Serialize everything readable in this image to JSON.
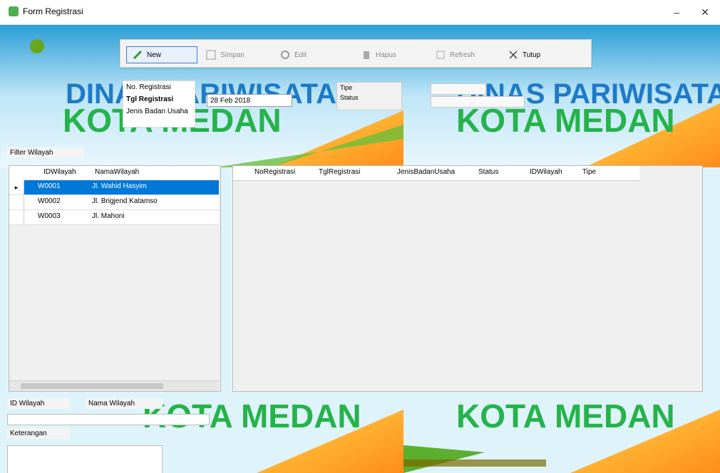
{
  "window": {
    "title": "Form Registrasi",
    "controls": {
      "minimize": "–",
      "close": "✕"
    }
  },
  "toolbar": {
    "buttons": [
      {
        "label": "New",
        "icon": "plus-icon",
        "active": true
      },
      {
        "label": "Simpan",
        "icon": "save-icon",
        "active": false
      },
      {
        "label": "Edit",
        "icon": "edit-icon",
        "active": false
      },
      {
        "label": "Hapus",
        "icon": "delete-icon",
        "active": false
      },
      {
        "label": "Refresh",
        "icon": "refresh-icon",
        "active": false
      },
      {
        "label": "Tutup",
        "icon": "close-icon",
        "active": false
      }
    ]
  },
  "form": {
    "panel_lines": [
      "No. Registrasi",
      "Tgl Registrasi",
      "Jenis Badan Usaha"
    ],
    "combo_value": "28 Feb 2018",
    "right_labels": [
      "Tipe",
      "Status"
    ]
  },
  "labels": {
    "filter": "Filter Wilayah",
    "id_wilayah": "ID Wilayah",
    "nama_wilayah": "Nama Wilayah",
    "keterangan": "Keterangan"
  },
  "left_grid": {
    "headers": [
      "IDWilayah",
      "NamaWilayah"
    ],
    "rows": [
      {
        "id": "W0001",
        "name": "Jl. Wahid Hasyim",
        "selected": true
      },
      {
        "id": "W0002",
        "name": "Jl. Brigjend Katamso",
        "selected": false
      },
      {
        "id": "W0003",
        "name": "Jl. Mahoni",
        "selected": false
      }
    ]
  },
  "right_grid": {
    "headers": [
      "NoRegistrasi",
      "TglRegistrasi",
      "JenisBadanUsaha",
      "Status",
      "IDWilayah",
      "Tipe"
    ]
  },
  "banner": {
    "line1": "DINAS PARIWISATA",
    "line2": "KOTA MEDAN"
  }
}
